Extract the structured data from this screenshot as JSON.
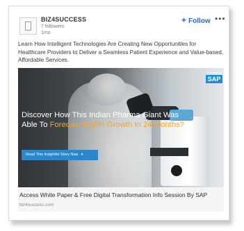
{
  "company": {
    "name": "BIZ4SUCCESS",
    "followers": "7 followers",
    "age": "1mo"
  },
  "actions": {
    "follow_icon": "+",
    "follow_label": "Follow",
    "more_label": "•••"
  },
  "post": {
    "text": "Learn How Intelligent Technologies Are Creating New Opportunities for Healthcare Providers to Deliver a Seamless Patient Experience and Value-based, Affordable Services."
  },
  "image": {
    "sap_small": "Powered by",
    "sap_logo": "SAP",
    "headline_part1": "Discover How This Indian Pharma Giant Was Able To ",
    "headline_highlight": "Forecast A 25% Growth In 24 Months?",
    "cta_label": "Read This Insightful Story Now",
    "cta_icon": "»"
  },
  "link": {
    "title": "Access White Paper & Free Digital Transformation Info Session By SAP",
    "url": "biz4success.com"
  },
  "colors": {
    "accent": "#2d66b6",
    "highlight": "#f5a623",
    "cta": "#2c86c9"
  }
}
